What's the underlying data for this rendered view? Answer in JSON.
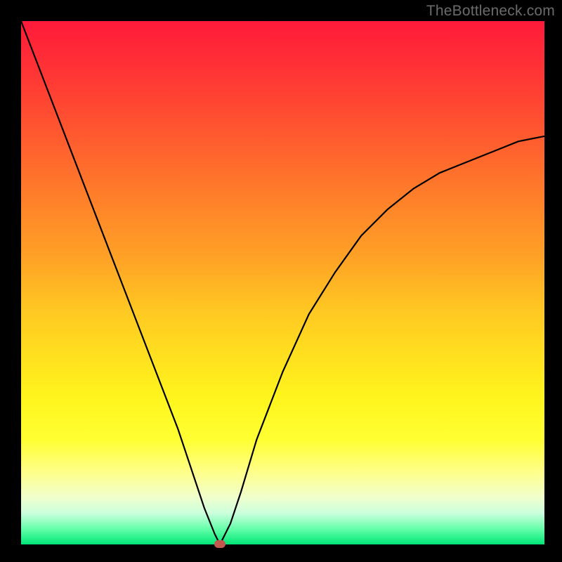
{
  "watermark": "TheBottleneck.com",
  "chart_data": {
    "type": "line",
    "title": "",
    "xlabel": "",
    "ylabel": "",
    "x_range": [
      0,
      100
    ],
    "y_range": [
      0,
      100
    ],
    "marker": {
      "x": 38,
      "y": 0
    },
    "series": [
      {
        "name": "curve",
        "x": [
          0,
          5,
          10,
          15,
          20,
          25,
          30,
          35,
          37,
          38,
          40,
          42,
          45,
          50,
          55,
          60,
          65,
          70,
          75,
          80,
          85,
          90,
          95,
          100
        ],
        "y": [
          100,
          87,
          74,
          61,
          48,
          35,
          22,
          7,
          2,
          0,
          4,
          10,
          20,
          33,
          44,
          52,
          59,
          64,
          68,
          71,
          73,
          75,
          77,
          78
        ]
      }
    ],
    "background_gradient": {
      "top": "#ff1a3a",
      "middle": "#ffe01f",
      "bottom": "#00e676"
    }
  }
}
